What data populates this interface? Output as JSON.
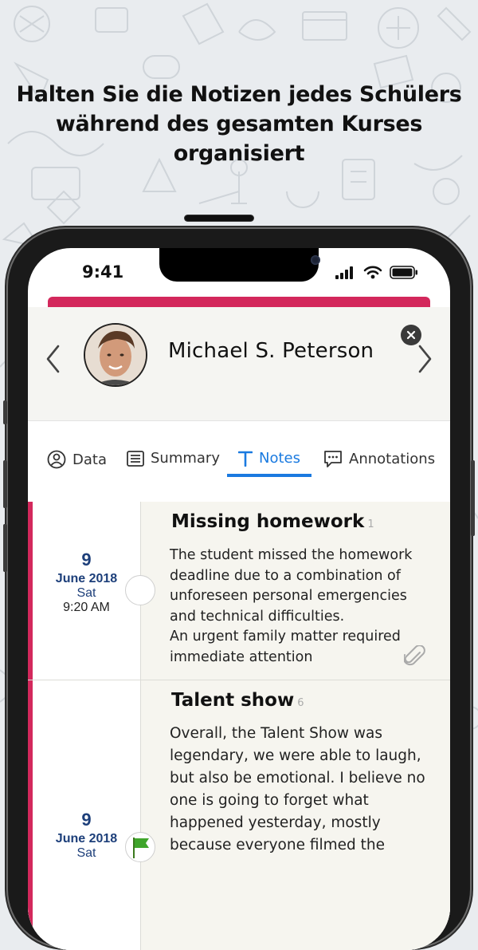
{
  "headline": "Halten Sie die Notizen jedes Schülers während des gesamten Kurses organisiert",
  "status_bar": {
    "time": "9:41"
  },
  "colors": {
    "accent": "#d3285c",
    "tab_active": "#1a7ae0",
    "date_text": "#1d3f7a"
  },
  "student": {
    "name": "Michael S. Peterson",
    "avatar_icon": "student-photo"
  },
  "tabs": [
    {
      "label": "Data",
      "icon": "person-circle-icon",
      "active": false
    },
    {
      "label": "Summary",
      "icon": "list-icon",
      "active": false
    },
    {
      "label": "Notes",
      "icon": "text-t-icon",
      "active": true
    },
    {
      "label": "Annotations",
      "icon": "comment-icon",
      "active": false
    }
  ],
  "notes": [
    {
      "day": "9",
      "month_year": "June 2018",
      "weekday": "Sat",
      "time": "9:20 AM",
      "title": "Missing homework",
      "count": "1",
      "body": [
        "The student missed the homework",
        "deadline due to a combination of",
        "unforeseen personal emergencies",
        "and technical difficulties.",
        "An urgent family matter required",
        "immediate attention"
      ],
      "has_attachment": true
    },
    {
      "day": "9",
      "month_year": "June 2018",
      "weekday": "Sat",
      "title": "Talent show",
      "count": "6",
      "body": [
        "Overall, the Talent Show was",
        "legendary, we were able to laugh,",
        "but also be emotional. I believe no",
        "one is going to forget what",
        "happened yesterday, mostly",
        "because everyone filmed the"
      ],
      "flag_icon": "green-flag-icon"
    }
  ]
}
